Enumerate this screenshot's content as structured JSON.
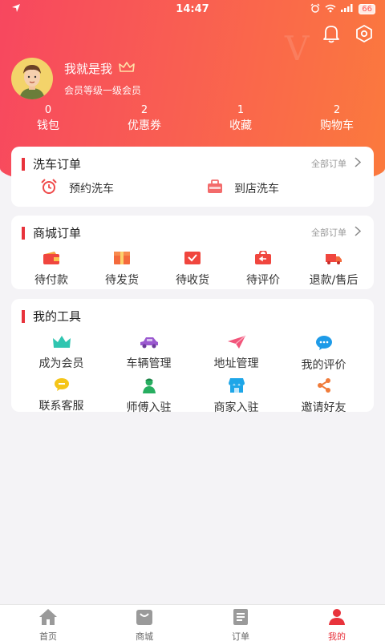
{
  "status": {
    "time": "14:47",
    "battery": "66"
  },
  "hero": {
    "watermark": "V"
  },
  "profile": {
    "name": "我就是我",
    "level": "会员等级一级会员"
  },
  "stats": [
    {
      "num": "0",
      "label": "钱包"
    },
    {
      "num": "2",
      "label": "优惠券"
    },
    {
      "num": "1",
      "label": "收藏"
    },
    {
      "num": "2",
      "label": "购物车"
    }
  ],
  "wash": {
    "title": "洗车订单",
    "more": "全部订单",
    "items": [
      {
        "label": "预约洗车",
        "icon": "alarm-clock-icon"
      },
      {
        "label": "到店洗车",
        "icon": "toolbox-icon"
      }
    ]
  },
  "mall": {
    "title": "商城订单",
    "more": "全部订单",
    "items": [
      {
        "label": "待付款",
        "icon": "wallet-icon"
      },
      {
        "label": "待发货",
        "icon": "box-icon"
      },
      {
        "label": "待收货",
        "icon": "receive-box-icon"
      },
      {
        "label": "待评价",
        "icon": "review-bag-icon"
      },
      {
        "label": "退款/售后",
        "icon": "truck-icon"
      }
    ]
  },
  "tools": {
    "title": "我的工具",
    "items": [
      {
        "label": "成为会员",
        "icon": "crown-icon",
        "color": "#2fc5b0"
      },
      {
        "label": "车辆管理",
        "icon": "car-icon",
        "color": "#9b59d0"
      },
      {
        "label": "地址管理",
        "icon": "paper-plane-icon",
        "color": "#f2557a"
      },
      {
        "label": "我的评价",
        "icon": "chat-bubble-icon",
        "color": "#1e9be8"
      },
      {
        "label": "联系客服",
        "icon": "message-icon",
        "color": "#f5c518"
      },
      {
        "label": "师傅入驻",
        "icon": "worker-icon",
        "color": "#27ae60"
      },
      {
        "label": "商家入驻",
        "icon": "shop-icon",
        "color": "#1ea6e8"
      },
      {
        "label": "邀请好友",
        "icon": "share-icon",
        "color": "#f07b3a"
      }
    ]
  },
  "tabs": [
    {
      "label": "首页",
      "icon": "home-icon"
    },
    {
      "label": "商城",
      "icon": "mall-icon"
    },
    {
      "label": "订单",
      "icon": "order-icon"
    },
    {
      "label": "我的",
      "icon": "user-icon",
      "active": true
    }
  ],
  "colors": {
    "accent": "#e8333c",
    "hero_start": "#f7475f",
    "hero_end": "#fb7a3d"
  }
}
